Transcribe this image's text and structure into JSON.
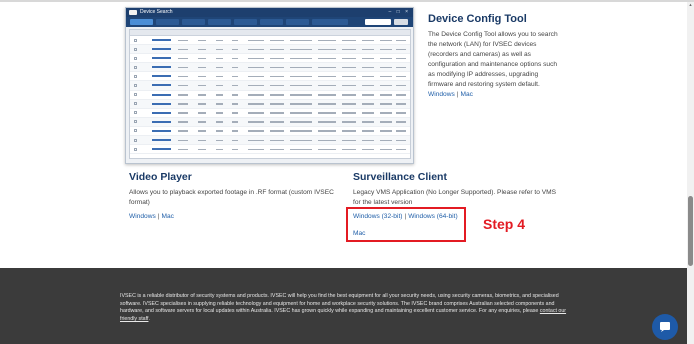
{
  "device_config_tool": {
    "heading": "Device Config Tool",
    "description": "The Device Config Tool allows you to search the network (LAN) for IVSEC devices (recorders and cameras) as well as configuration and maintenance options such as modifying IP addresses, upgrading firmware and restoring system default.",
    "link_windows": "Windows",
    "separator": "|",
    "link_mac": "Mac",
    "screenshot_title": "Device Search"
  },
  "video_player": {
    "heading": "Video Player",
    "description": "Allows you to playback exported footage in .RF format (custom IVSEC format)",
    "link_windows": "Windows",
    "separator": "|",
    "link_mac": "Mac"
  },
  "surveillance_client": {
    "heading": "Surveillance Client",
    "description": "Legacy VMS Application (No Longer Supported). Please refer to VMS for the latest version",
    "link_win32": "Windows (32-bit)",
    "separator": "|",
    "link_win64": "Windows (64-bit)",
    "link_mac": "Mac"
  },
  "annotation": {
    "step_label": "Step 4",
    "color": "#e31b23"
  },
  "footer": {
    "text": "IVSEC is a reliable distributor of security systems and products. IVSEC will help you find the best equipment for all your security needs, using security cameras, biometrics, and specialised software. IVSEC specialises in supplying reliable technology and equipment for home and workplace security solutions. The IVSEC brand comprises Australian selected components and hardware, and software servers for local updates within Australia. IVSEC has grown quickly while expanding and maintaining excellent customer service. For any enquiries, please",
    "link": "contact our friendly staff",
    "end": "."
  },
  "colors": {
    "heading": "#1a3a66",
    "link": "#1f5ea8",
    "footer_bg": "#3b3b3b",
    "chat": "#1e5aa8"
  },
  "icons": [
    "device-search-logo-icon",
    "chat-icon",
    "scroll-up-arrow-icon"
  ]
}
